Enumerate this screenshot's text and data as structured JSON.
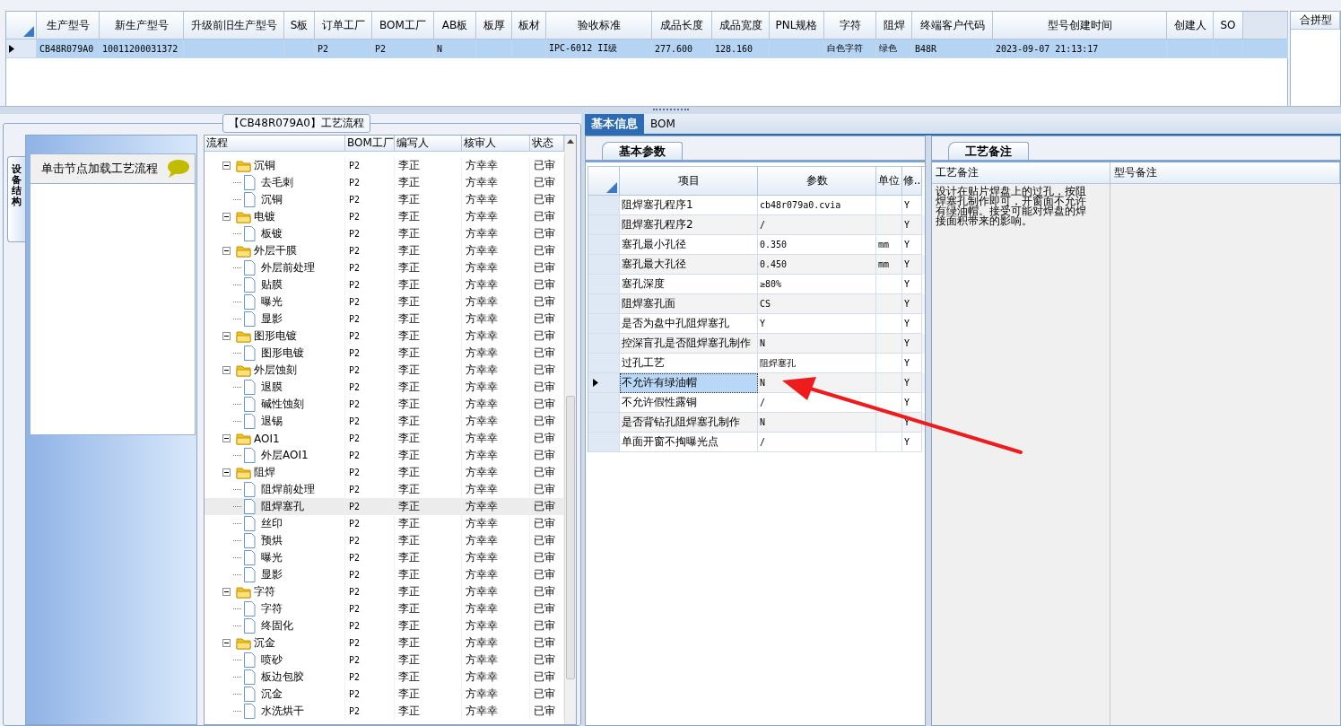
{
  "product_grid": {
    "row_selected": true,
    "columns": [
      {
        "header": "生产型号",
        "value": "CB48R079A0"
      },
      {
        "header": "新生产型号",
        "value": "10011200031372"
      },
      {
        "header": "升级前旧生产型号"
      },
      {
        "header": "S板"
      },
      {
        "header": "订单工厂",
        "value": "P2"
      },
      {
        "header": "BOM工厂",
        "value": "P2"
      },
      {
        "header": "AB板",
        "value": "N"
      },
      {
        "header": "板厚"
      },
      {
        "header": "板材"
      },
      {
        "header": "验收标准",
        "value": "IPC-6012 II级"
      },
      {
        "header": "成品长度",
        "value": "277.600"
      },
      {
        "header": "成品宽度",
        "value": "128.160"
      },
      {
        "header": "PNL规格"
      },
      {
        "header": "字符",
        "value": "白色字符"
      },
      {
        "header": "阻焊",
        "value": "绿色"
      },
      {
        "header": "终端客户代码",
        "value": "B48R"
      },
      {
        "header": "型号创建时间",
        "value": "2023-09-07 21:13:17"
      },
      {
        "header": "创建人"
      },
      {
        "header": "SO"
      }
    ]
  },
  "side_panel": {
    "header": "合拼型"
  },
  "flow": {
    "title": "【CB48R079A0】工艺流程",
    "side_tab": "设备结构",
    "hint": "单击节点加载工艺流程",
    "columns": [
      "流程",
      "BOM工厂",
      "编写人",
      "核审人",
      "状态"
    ],
    "nodes": [
      {
        "kind": "folder",
        "label": "沉铜",
        "bom": "P2",
        "writer": "李正",
        "reviewer": "方幸幸",
        "status": "已审",
        "selected": false,
        "children": [
          {
            "kind": "file",
            "label": "去毛刺",
            "bom": "P2",
            "writer": "李正",
            "reviewer": "方幸幸",
            "status": "已审",
            "selected": false
          },
          {
            "kind": "file",
            "label": "沉铜",
            "bom": "P2",
            "writer": "李正",
            "reviewer": "方幸幸",
            "status": "已审",
            "selected": false
          }
        ]
      },
      {
        "kind": "folder",
        "label": "电镀",
        "bom": "P2",
        "writer": "李正",
        "reviewer": "方幸幸",
        "status": "已审",
        "selected": false,
        "children": [
          {
            "kind": "file",
            "label": "板镀",
            "bom": "P2",
            "writer": "李正",
            "reviewer": "方幸幸",
            "status": "已审",
            "selected": false
          }
        ]
      },
      {
        "kind": "folder",
        "label": "外层干膜",
        "bom": "P2",
        "writer": "李正",
        "reviewer": "方幸幸",
        "status": "已审",
        "selected": false,
        "children": [
          {
            "kind": "file",
            "label": "外层前处理",
            "bom": "P2",
            "writer": "李正",
            "reviewer": "方幸幸",
            "status": "已审",
            "selected": false
          },
          {
            "kind": "file",
            "label": "贴膜",
            "bom": "P2",
            "writer": "李正",
            "reviewer": "方幸幸",
            "status": "已审",
            "selected": false
          },
          {
            "kind": "file",
            "label": "曝光",
            "bom": "P2",
            "writer": "李正",
            "reviewer": "方幸幸",
            "status": "已审",
            "selected": false
          },
          {
            "kind": "file",
            "label": "显影",
            "bom": "P2",
            "writer": "李正",
            "reviewer": "方幸幸",
            "status": "已审",
            "selected": false
          }
        ]
      },
      {
        "kind": "folder",
        "label": "图形电镀",
        "bom": "P2",
        "writer": "李正",
        "reviewer": "方幸幸",
        "status": "已审",
        "selected": false,
        "children": [
          {
            "kind": "file",
            "label": "图形电镀",
            "bom": "P2",
            "writer": "李正",
            "reviewer": "方幸幸",
            "status": "已审",
            "selected": false
          }
        ]
      },
      {
        "kind": "folder",
        "label": "外层蚀刻",
        "bom": "P2",
        "writer": "李正",
        "reviewer": "方幸幸",
        "status": "已审",
        "selected": false,
        "children": [
          {
            "kind": "file",
            "label": "退膜",
            "bom": "P2",
            "writer": "李正",
            "reviewer": "方幸幸",
            "status": "已审",
            "selected": false
          },
          {
            "kind": "file",
            "label": "碱性蚀刻",
            "bom": "P2",
            "writer": "李正",
            "reviewer": "方幸幸",
            "status": "已审",
            "selected": false
          },
          {
            "kind": "file",
            "label": "退锡",
            "bom": "P2",
            "writer": "李正",
            "reviewer": "方幸幸",
            "status": "已审",
            "selected": false
          }
        ]
      },
      {
        "kind": "folder",
        "label": "AOI1",
        "bom": "P2",
        "writer": "李正",
        "reviewer": "方幸幸",
        "status": "已审",
        "selected": false,
        "children": [
          {
            "kind": "file",
            "label": "外层AOI1",
            "bom": "P2",
            "writer": "李正",
            "reviewer": "方幸幸",
            "status": "已审",
            "selected": false
          }
        ]
      },
      {
        "kind": "folder",
        "label": "阻焊",
        "bom": "P2",
        "writer": "李正",
        "reviewer": "方幸幸",
        "status": "已审",
        "selected": false,
        "children": [
          {
            "kind": "file",
            "label": "阻焊前处理",
            "bom": "P2",
            "writer": "李正",
            "reviewer": "方幸幸",
            "status": "已审",
            "selected": false
          },
          {
            "kind": "file",
            "label": "阻焊塞孔",
            "bom": "P2",
            "writer": "李正",
            "reviewer": "方幸幸",
            "status": "已审",
            "selected": true
          },
          {
            "kind": "file",
            "label": "丝印",
            "bom": "P2",
            "writer": "李正",
            "reviewer": "方幸幸",
            "status": "已审",
            "selected": false
          },
          {
            "kind": "file",
            "label": "预烘",
            "bom": "P2",
            "writer": "李正",
            "reviewer": "方幸幸",
            "status": "已审",
            "selected": false
          },
          {
            "kind": "file",
            "label": "曝光",
            "bom": "P2",
            "writer": "李正",
            "reviewer": "方幸幸",
            "status": "已审",
            "selected": false
          },
          {
            "kind": "file",
            "label": "显影",
            "bom": "P2",
            "writer": "李正",
            "reviewer": "方幸幸",
            "status": "已审",
            "selected": false
          }
        ]
      },
      {
        "kind": "folder",
        "label": "字符",
        "bom": "P2",
        "writer": "李正",
        "reviewer": "方幸幸",
        "status": "已审",
        "selected": false,
        "children": [
          {
            "kind": "file",
            "label": "字符",
            "bom": "P2",
            "writer": "李正",
            "reviewer": "方幸幸",
            "status": "已审",
            "selected": false
          },
          {
            "kind": "file",
            "label": "终固化",
            "bom": "P2",
            "writer": "李正",
            "reviewer": "方幸幸",
            "status": "已审",
            "selected": false
          }
        ]
      },
      {
        "kind": "folder",
        "label": "沉金",
        "bom": "P2",
        "writer": "李正",
        "reviewer": "方幸幸",
        "status": "已审",
        "selected": false,
        "children": [
          {
            "kind": "file",
            "label": "喷砂",
            "bom": "P2",
            "writer": "李正",
            "reviewer": "方幸幸",
            "status": "已审",
            "selected": false
          },
          {
            "kind": "file",
            "label": "板边包胶",
            "bom": "P2",
            "writer": "李正",
            "reviewer": "方幸幸",
            "status": "已审",
            "selected": false
          },
          {
            "kind": "file",
            "label": "沉金",
            "bom": "P2",
            "writer": "李正",
            "reviewer": "方幸幸",
            "status": "已审",
            "selected": false
          },
          {
            "kind": "file",
            "label": "水洗烘干",
            "bom": "P2",
            "writer": "李正",
            "reviewer": "方幸幸",
            "status": "已审",
            "selected": false
          }
        ]
      }
    ]
  },
  "info": {
    "tabs": [
      {
        "label": "基本信息",
        "selected": true
      },
      {
        "label": "BOM",
        "selected": false
      }
    ],
    "params": {
      "tab": "基本参数",
      "columns": [
        "项目",
        "参数",
        "单位",
        "修.."
      ],
      "rows": [
        {
          "item": "阻焊塞孔程序1",
          "value": "cb48r079a0.cvia",
          "flag": "Y",
          "selected": false
        },
        {
          "item": "阻焊塞孔程序2",
          "value": "/",
          "flag": "Y",
          "selected": false
        },
        {
          "item": "塞孔最小孔径",
          "value": "0.350",
          "unit": "mm",
          "flag": "Y",
          "selected": false
        },
        {
          "item": "塞孔最大孔径",
          "value": "0.450",
          "unit": "mm",
          "flag": "Y",
          "selected": false
        },
        {
          "item": "塞孔深度",
          "value": "≥80%",
          "flag": "Y",
          "selected": false
        },
        {
          "item": "阻焊塞孔面",
          "value": "CS",
          "flag": "Y",
          "selected": false
        },
        {
          "item": "是否为盘中孔阻焊塞孔",
          "value": "Y",
          "flag": "Y",
          "selected": false
        },
        {
          "item": "控深盲孔是否阻焊塞孔制作",
          "value": "N",
          "flag": "Y",
          "selected": false
        },
        {
          "item": "过孔工艺",
          "value": "阻焊塞孔",
          "flag": "Y",
          "selected": false
        },
        {
          "item": "不允许有绿油帽",
          "value": "N",
          "flag": "Y",
          "selected": true
        },
        {
          "item": "不允许假性露铜",
          "value": "/",
          "flag": "Y",
          "selected": false
        },
        {
          "item": "是否背钻孔阻焊塞孔制作",
          "value": "N",
          "flag": "Y",
          "selected": false
        },
        {
          "item": "单面开窗不掏曝光点",
          "value": "/",
          "flag": "Y",
          "selected": false
        }
      ]
    },
    "notes": {
      "tab": "工艺备注",
      "columns": [
        "工艺备注",
        "型号备注"
      ],
      "text": "设计在贴片焊盘上的过孔，按阻焊塞孔制作即可，开窗面不允许有绿油帽。接受可能对焊盘的焊接面积带来的影响。"
    }
  }
}
